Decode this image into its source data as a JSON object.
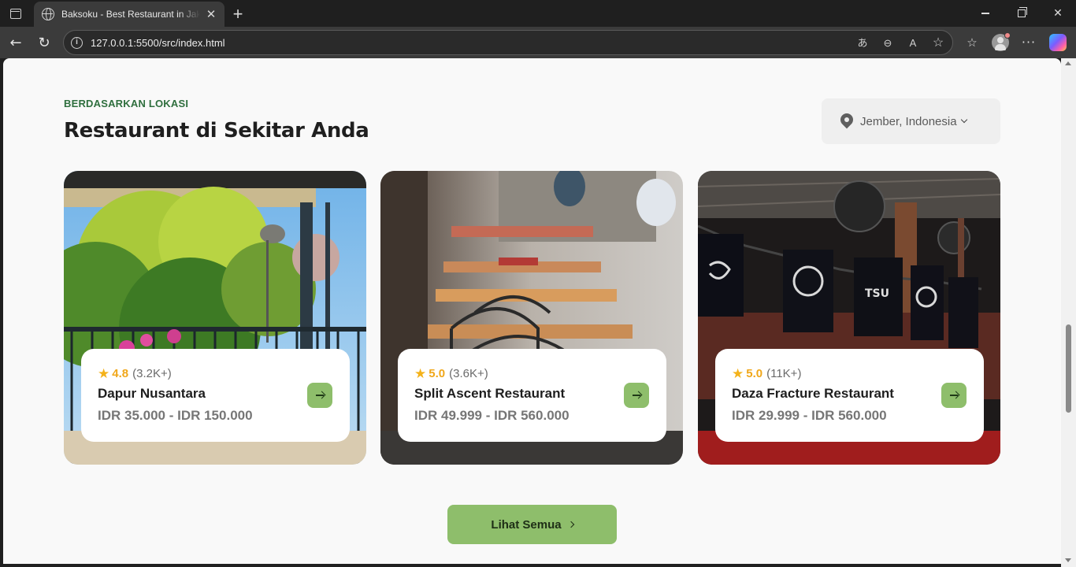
{
  "browser": {
    "tab_title": "Baksoku - Best Restaurant in Jakarta",
    "url": "127.0.0.1:5500/src/index.html"
  },
  "section": {
    "eyebrow": "BERDASARKAN LOKASI",
    "title": "Restaurant di Sekitar Anda",
    "location": "Jember, Indonesia"
  },
  "restaurants": [
    {
      "rating": "4.8",
      "reviews": "(3.2K+)",
      "name": "Dapur Nusantara",
      "price": "IDR 35.000 - IDR 150.000"
    },
    {
      "rating": "5.0",
      "reviews": "(3.6K+)",
      "name": "Split Ascent Restaurant",
      "price": "IDR 49.999 - IDR 560.000"
    },
    {
      "rating": "5.0",
      "reviews": "(11K+)",
      "name": "Daza Fracture Restaurant",
      "price": "IDR 29.999 - IDR 560.000"
    }
  ],
  "see_all_label": "Lihat Semua",
  "colors": {
    "accent_green": "#8ebe6b",
    "eyebrow_green": "#2f6f3e",
    "star": "#f4b21a"
  }
}
